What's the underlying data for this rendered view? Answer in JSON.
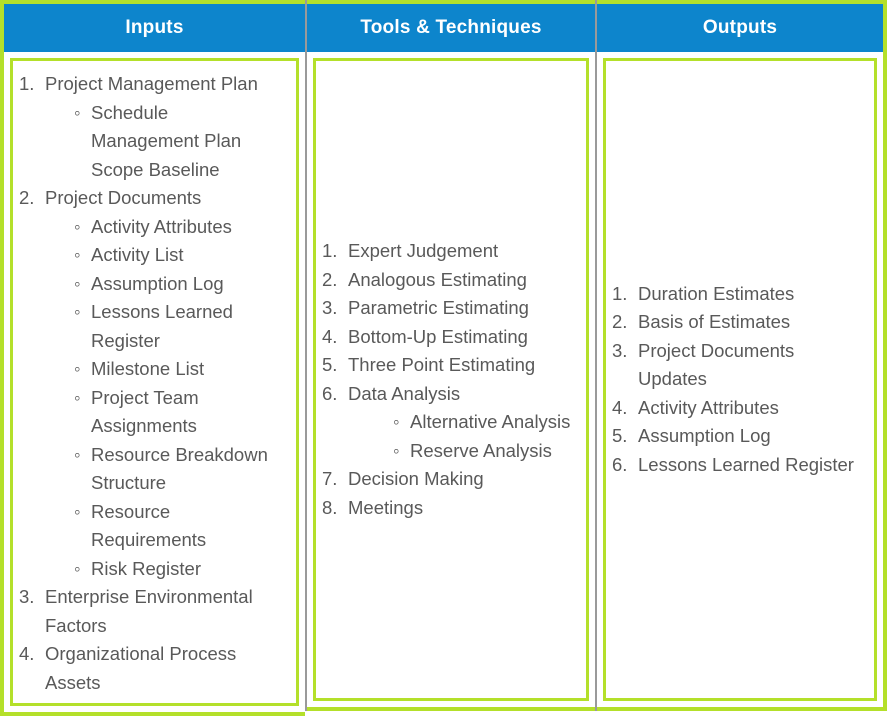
{
  "colors": {
    "header_bg": "#0d85cc",
    "header_text": "#ffffff",
    "border_green": "#b4e02a",
    "divider_gray": "#9a9a9a",
    "body_text": "#595959",
    "card_bg": "#ffffff"
  },
  "columns": [
    {
      "id": "inputs",
      "header": "Inputs",
      "items": [
        {
          "num": "1.",
          "text": "Project Management Plan",
          "sub": [
            {
              "bullet": true,
              "text": "Schedule"
            },
            {
              "bullet": false,
              "text": "Management Plan"
            },
            {
              "bullet": false,
              "text": "Scope Baseline"
            }
          ]
        },
        {
          "num": "2.",
          "text": "Project Documents",
          "sub": [
            {
              "bullet": true,
              "text": "Activity Attributes"
            },
            {
              "bullet": true,
              "text": "Activity List"
            },
            {
              "bullet": true,
              "text": "Assumption Log"
            },
            {
              "bullet": true,
              "text": "Lessons Learned"
            },
            {
              "bullet": false,
              "text": "Register"
            },
            {
              "bullet": true,
              "text": "Milestone List"
            },
            {
              "bullet": true,
              "text": "Project Team"
            },
            {
              "bullet": false,
              "text": "Assignments"
            },
            {
              "bullet": true,
              "text": "Resource Breakdown"
            },
            {
              "bullet": false,
              "text": "Structure"
            },
            {
              "bullet": true,
              "text": "Resource"
            },
            {
              "bullet": false,
              "text": "Requirements"
            },
            {
              "bullet": true,
              "text": "Risk Register"
            }
          ]
        },
        {
          "num": "3.",
          "text": "Enterprise Environmental Factors",
          "sub": []
        },
        {
          "num": "4.",
          "text": "Organizational Process Assets",
          "sub": []
        }
      ]
    },
    {
      "id": "tools",
      "header": "Tools & Techniques",
      "items": [
        {
          "num": "1.",
          "text": "Expert Judgement",
          "sub": []
        },
        {
          "num": "2.",
          "text": "Analogous Estimating",
          "sub": []
        },
        {
          "num": "3.",
          "text": "Parametric Estimating",
          "sub": []
        },
        {
          "num": "4.",
          "text": "Bottom-Up Estimating",
          "sub": []
        },
        {
          "num": "5.",
          "text": "Three Point Estimating",
          "sub": []
        },
        {
          "num": "6.",
          "text": "Data Analysis",
          "sub": [
            {
              "bullet": true,
              "text": "Alternative Analysis"
            },
            {
              "bullet": true,
              "text": "Reserve Analysis"
            }
          ]
        },
        {
          "num": "7.",
          "text": "Decision Making",
          "sub": []
        },
        {
          "num": "8.",
          "text": "Meetings",
          "sub": []
        }
      ]
    },
    {
      "id": "outputs",
      "header": "Outputs",
      "items": [
        {
          "num": "1.",
          "text": "Duration Estimates",
          "sub": []
        },
        {
          "num": "2.",
          "text": "Basis of Estimates",
          "sub": []
        },
        {
          "num": "3.",
          "text": "Project Documents Updates",
          "sub": []
        },
        {
          "num": "4.",
          "text": "Activity Attributes",
          "sub": []
        },
        {
          "num": "5.",
          "text": "Assumption Log",
          "sub": []
        },
        {
          "num": "6.",
          "text": "Lessons Learned Register",
          "sub": []
        }
      ]
    }
  ],
  "glyphs": {
    "sub_bullet": "◦"
  }
}
